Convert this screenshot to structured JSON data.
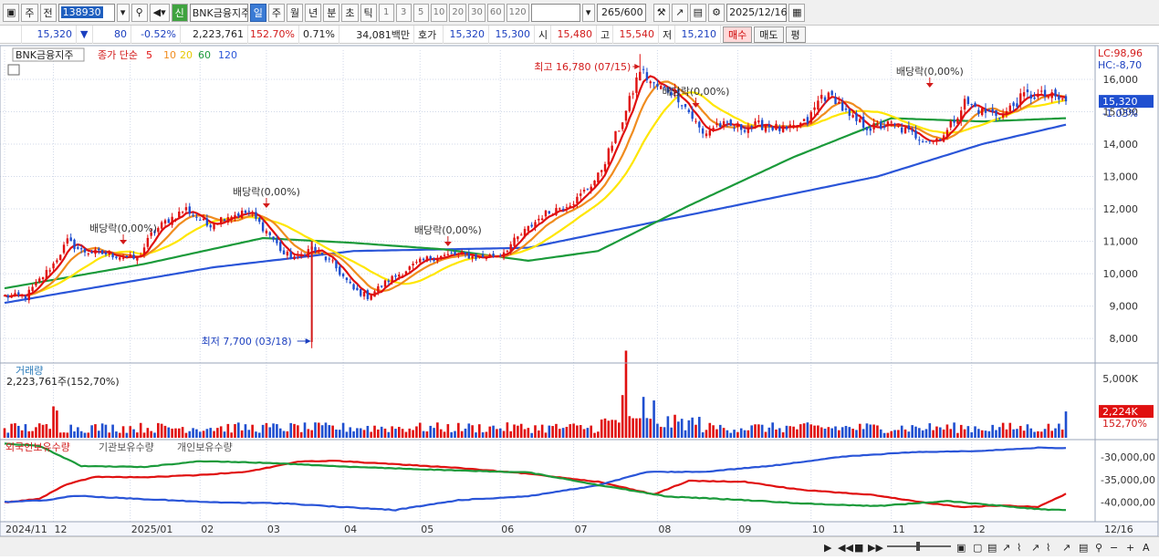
{
  "toolbar": {
    "period_label": "주",
    "prev_label": "전",
    "code": "138930",
    "stock_name": "BNK금융지주",
    "badge": "신",
    "periods": [
      "일",
      "주",
      "월",
      "년",
      "분",
      "초",
      "틱"
    ],
    "active_period": "일",
    "intervals": [
      "1",
      "3",
      "5",
      "10",
      "20",
      "30",
      "60",
      "120"
    ],
    "count": "265",
    "count_max": "/600",
    "date": "2025/12/16"
  },
  "infobar": {
    "price": "15,320",
    "change": "80",
    "change_pct": "-0.52%",
    "volume": "2,223,761",
    "volume_pct": "152.70%",
    "turnover_pct": "0.71%",
    "amount": "34,081백만",
    "quote_label": "호가",
    "ask": "15,320",
    "bid": "15,300",
    "open_label": "시",
    "open": "15,480",
    "high_label": "고",
    "high": "15,540",
    "low_label": "저",
    "low": "15,210",
    "buy_label": "매수",
    "sell_label": "매도",
    "avg_label": "평"
  },
  "colors": {
    "up": "#e01010",
    "down": "#1f4fd0",
    "ma5": "#e01010",
    "ma10": "#f08c1e",
    "ma20": "#ffe600",
    "ma60": "#1a9a3a",
    "ma120": "#2a55d8"
  },
  "chart_data": [
    {
      "type": "candlestick",
      "title": "BNK금융지주",
      "legend_prefix": "종가 단순",
      "legend": [
        "5",
        "10",
        "20",
        "60",
        "120"
      ],
      "ylim": [
        7300,
        16900
      ],
      "y_ticks": [
        "16,000",
        "15,000",
        "14,000",
        "13,000",
        "12,000",
        "11,000",
        "10,000",
        "9,000",
        "8,000"
      ],
      "y_tick_values": [
        16000,
        15000,
        14000,
        13000,
        12000,
        11000,
        10000,
        9000,
        8000
      ],
      "x_labels": [
        "2024/11",
        "12",
        "2025/01",
        "02",
        "03",
        "04",
        "05",
        "06",
        "07",
        "08",
        "09",
        "10",
        "11",
        "12"
      ],
      "lc_label": "LC:98,96",
      "hc_label": "HC:-8,70",
      "current_price_label": "15,320",
      "current_pct_label": "-1.03%",
      "high_marker": "최고 16,780 (07/15)",
      "low_marker": "최저 7,700 (03/18)",
      "dividend_labels": [
        "배당락(0,00%)",
        "배당락(0,00%)",
        "배당락(0,00%)",
        "배당락(0,00%)",
        "배당락(0,00%)"
      ],
      "anchors_close": [
        [
          0,
          9300
        ],
        [
          6,
          9300
        ],
        [
          14,
          10300
        ],
        [
          18,
          11000
        ],
        [
          22,
          10700
        ],
        [
          30,
          10600
        ],
        [
          38,
          10450
        ],
        [
          42,
          11200
        ],
        [
          46,
          11600
        ],
        [
          52,
          12000
        ],
        [
          58,
          11500
        ],
        [
          64,
          11800
        ],
        [
          70,
          11900
        ],
        [
          76,
          11200
        ],
        [
          80,
          10600
        ],
        [
          84,
          10500
        ],
        [
          88,
          10800
        ],
        [
          94,
          10300
        ],
        [
          100,
          9500
        ],
        [
          104,
          9300
        ],
        [
          110,
          9800
        ],
        [
          118,
          10300
        ],
        [
          122,
          10500
        ],
        [
          130,
          10600
        ],
        [
          136,
          10500
        ],
        [
          142,
          10600
        ],
        [
          148,
          11200
        ],
        [
          154,
          11800
        ],
        [
          158,
          12000
        ],
        [
          164,
          12300
        ],
        [
          170,
          13000
        ],
        [
          174,
          14000
        ],
        [
          178,
          15000
        ],
        [
          182,
          16300
        ],
        [
          186,
          15800
        ],
        [
          192,
          15600
        ],
        [
          196,
          15000
        ],
        [
          200,
          14300
        ],
        [
          204,
          14600
        ],
        [
          210,
          14500
        ],
        [
          218,
          14600
        ],
        [
          224,
          14400
        ],
        [
          230,
          14700
        ],
        [
          234,
          15500
        ],
        [
          238,
          15400
        ],
        [
          242,
          14800
        ],
        [
          248,
          14500
        ],
        [
          254,
          14600
        ],
        [
          260,
          14300
        ],
        [
          266,
          14100
        ],
        [
          270,
          14400
        ],
        [
          275,
          15300
        ],
        [
          280,
          15000
        ],
        [
          286,
          14900
        ],
        [
          292,
          15500
        ],
        [
          298,
          15500
        ],
        [
          304,
          15320
        ]
      ],
      "anchors_ma60": [
        [
          0,
          9550
        ],
        [
          40,
          10300
        ],
        [
          74,
          11100
        ],
        [
          100,
          10950
        ],
        [
          126,
          10750
        ],
        [
          150,
          10400
        ],
        [
          170,
          10700
        ],
        [
          196,
          12100
        ],
        [
          226,
          13600
        ],
        [
          254,
          14800
        ],
        [
          280,
          14700
        ],
        [
          304,
          14800
        ]
      ],
      "anchors_ma120": [
        [
          0,
          9100
        ],
        [
          60,
          10200
        ],
        [
          100,
          10700
        ],
        [
          150,
          10800
        ],
        [
          200,
          11900
        ],
        [
          250,
          13000
        ],
        [
          280,
          14000
        ],
        [
          304,
          14600
        ]
      ]
    },
    {
      "type": "bar",
      "title": "거래량",
      "value_label": "2,223,761주(152,70%)",
      "ylim": [
        0,
        6000000
      ],
      "y_ticks": [
        "5,000K"
      ],
      "y_tick_values": [
        5000000
      ],
      "current_label": "2,224K",
      "current_pct_label": "152,70%",
      "current_value": 2223761
    },
    {
      "type": "line",
      "series": [
        {
          "name": "외국인보유수량",
          "color": "#e01010",
          "anchors": [
            [
              0,
              -40100000
            ],
            [
              10,
              -39300000
            ],
            [
              18,
              -36000000
            ],
            [
              26,
              -34400000
            ],
            [
              40,
              -34500000
            ],
            [
              56,
              -34000000
            ],
            [
              70,
              -33200000
            ],
            [
              84,
              -31000000
            ],
            [
              94,
              -30800000
            ],
            [
              110,
              -31500000
            ],
            [
              128,
              -32300000
            ],
            [
              150,
              -33700000
            ],
            [
              170,
              -35500000
            ],
            [
              186,
              -38300000
            ],
            [
              196,
              -35300000
            ],
            [
              212,
              -35500000
            ],
            [
              228,
              -37300000
            ],
            [
              248,
              -38400000
            ],
            [
              262,
              -40000000
            ],
            [
              274,
              -41100000
            ],
            [
              286,
              -40800000
            ],
            [
              296,
              -41100000
            ],
            [
              304,
              -38200000
            ]
          ]
        },
        {
          "name": "기관보유수량",
          "color": "#2a55d8",
          "anchors": [
            [
              0,
              -40000000
            ],
            [
              12,
              -39600000
            ],
            [
              20,
              -38600000
            ],
            [
              30,
              -39000000
            ],
            [
              60,
              -40100000
            ],
            [
              80,
              -40300000
            ],
            [
              96,
              -41100000
            ],
            [
              112,
              -41800000
            ],
            [
              130,
              -39600000
            ],
            [
              150,
              -38700000
            ],
            [
              170,
              -36300000
            ],
            [
              184,
              -33300000
            ],
            [
              200,
              -33300000
            ],
            [
              220,
              -31900000
            ],
            [
              240,
              -29900000
            ],
            [
              260,
              -28900000
            ],
            [
              280,
              -28600000
            ],
            [
              296,
              -27900000
            ],
            [
              304,
              -28000000
            ]
          ]
        },
        {
          "name": "개인보유수량",
          "color": "#1a9a3a",
          "anchors": [
            [
              0,
              -27000000
            ],
            [
              10,
              -27500000
            ],
            [
              22,
              -32000000
            ],
            [
              40,
              -32200000
            ],
            [
              56,
              -30900000
            ],
            [
              76,
              -31300000
            ],
            [
              100,
              -32200000
            ],
            [
              130,
              -33000000
            ],
            [
              150,
              -33400000
            ],
            [
              170,
              -36200000
            ],
            [
              190,
              -38800000
            ],
            [
              210,
              -39500000
            ],
            [
              230,
              -40400000
            ],
            [
              250,
              -40900000
            ],
            [
              270,
              -39800000
            ],
            [
              286,
              -40900000
            ],
            [
              298,
              -41700000
            ],
            [
              304,
              -41800000
            ]
          ]
        }
      ],
      "ylim": [
        -44000000,
        -26500000
      ],
      "y_ticks": [
        "-30,000,00",
        "-35,000,00",
        "-40,000,00"
      ],
      "y_tick_values": [
        -30000000,
        -35000000,
        -40000000
      ],
      "end_label": "12/16"
    }
  ]
}
